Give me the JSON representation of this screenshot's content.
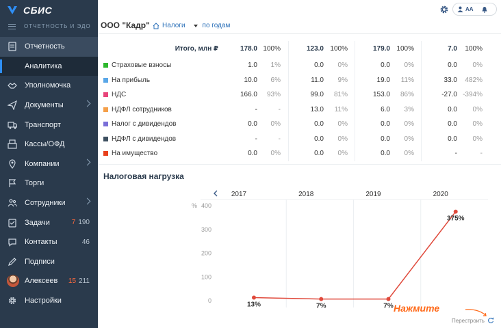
{
  "app": {
    "name": "СБИС",
    "section": "ОТЧЕТНОСТЬ И ЭДО"
  },
  "nav": [
    {
      "key": "reports",
      "label": "Отчетность",
      "icon": "report-icon",
      "active": true
    },
    {
      "key": "analytics",
      "label": "Аналитика",
      "child": true
    },
    {
      "key": "authority",
      "label": "Уполномочка",
      "icon": "handshake-icon"
    },
    {
      "key": "documents",
      "label": "Документы",
      "icon": "send-icon",
      "chevron": true
    },
    {
      "key": "transport",
      "label": "Транспорт",
      "icon": "truck-icon"
    },
    {
      "key": "cash",
      "label": "Кассы/ОФД",
      "icon": "register-icon"
    },
    {
      "key": "companies",
      "label": "Компании",
      "icon": "pin-icon",
      "chevron": true
    },
    {
      "key": "tenders",
      "label": "Торги",
      "icon": "flag-icon"
    },
    {
      "key": "employees",
      "label": "Сотрудники",
      "icon": "people-icon",
      "chevron": true
    },
    {
      "key": "tasks",
      "label": "Задачи",
      "icon": "tasks-icon",
      "red": "7",
      "grey": "190"
    },
    {
      "key": "contacts",
      "label": "Контакты",
      "icon": "chat-icon",
      "grey": "46"
    },
    {
      "key": "signatures",
      "label": "Подписи",
      "icon": "pen-icon"
    },
    {
      "key": "user",
      "label": "Алексеев",
      "icon": "avatar",
      "red": "15",
      "grey": "211"
    },
    {
      "key": "settings",
      "label": "Настройки",
      "icon": "gear-icon"
    }
  ],
  "header": {
    "org": "ООО \"Кадр\"",
    "org_quote": "\"",
    "crumb_taxes": "Налоги",
    "crumb_period": "по годам",
    "font_btn": "АА"
  },
  "table": {
    "total_label": "Итого, млн ₽",
    "totals": [
      {
        "v": "178.0",
        "p": "100%"
      },
      {
        "v": "123.0",
        "p": "100%"
      },
      {
        "v": "179.0",
        "p": "100%"
      },
      {
        "v": "7.0",
        "p": "100%"
      }
    ],
    "rows": [
      {
        "label": "Страховые взносы",
        "color": "#2eb82e",
        "cells": [
          [
            "1.0",
            "1%"
          ],
          [
            "0.0",
            "0%"
          ],
          [
            "0.0",
            "0%"
          ],
          [
            "0.0",
            "0%"
          ]
        ]
      },
      {
        "label": "На прибыль",
        "color": "#5aa7e8",
        "cells": [
          [
            "10.0",
            "6%"
          ],
          [
            "11.0",
            "9%"
          ],
          [
            "19.0",
            "11%"
          ],
          [
            "33.0",
            "482%"
          ]
        ]
      },
      {
        "label": "НДС",
        "color": "#e8457a",
        "cells": [
          [
            "166.0",
            "93%"
          ],
          [
            "99.0",
            "81%"
          ],
          [
            "153.0",
            "86%"
          ],
          [
            "-27.0",
            "-394%"
          ]
        ]
      },
      {
        "label": "НДФЛ сотрудников",
        "color": "#f5a04a",
        "cells": [
          [
            "-",
            "-"
          ],
          [
            "13.0",
            "11%"
          ],
          [
            "6.0",
            "3%"
          ],
          [
            "0.0",
            "0%"
          ]
        ]
      },
      {
        "label": "Налог с дивидендов",
        "color": "#7a6fd8",
        "cells": [
          [
            "0.0",
            "0%"
          ],
          [
            "0.0",
            "0%"
          ],
          [
            "0.0",
            "0%"
          ],
          [
            "0.0",
            "0%"
          ]
        ]
      },
      {
        "label": "НДФЛ с дивидендов",
        "color": "#3d5060",
        "cells": [
          [
            "-",
            "-"
          ],
          [
            "0.0",
            "0%"
          ],
          [
            "0.0",
            "0%"
          ],
          [
            "0.0",
            "0%"
          ]
        ]
      },
      {
        "label": "На имущество",
        "color": "#e8401c",
        "cells": [
          [
            "0.0",
            "0%"
          ],
          [
            "0.0",
            "0%"
          ],
          [
            "0.0",
            "0%"
          ],
          [
            "-",
            "-"
          ]
        ]
      }
    ]
  },
  "chart_title": "Налоговая нагрузка",
  "chart_data": {
    "type": "line",
    "categories": [
      "2017",
      "2018",
      "2019",
      "2020"
    ],
    "values": [
      13,
      7,
      7,
      375
    ],
    "labels": [
      "13%",
      "7%",
      "7%",
      "375%"
    ],
    "ylabel": "%",
    "yticks": [
      "0",
      "100",
      "200",
      "300",
      "400"
    ],
    "ylim": [
      0,
      400
    ],
    "grid": true,
    "line_color": "#e04a3c"
  },
  "hint": "Нажмите",
  "rebuild_label": "Перестроить"
}
